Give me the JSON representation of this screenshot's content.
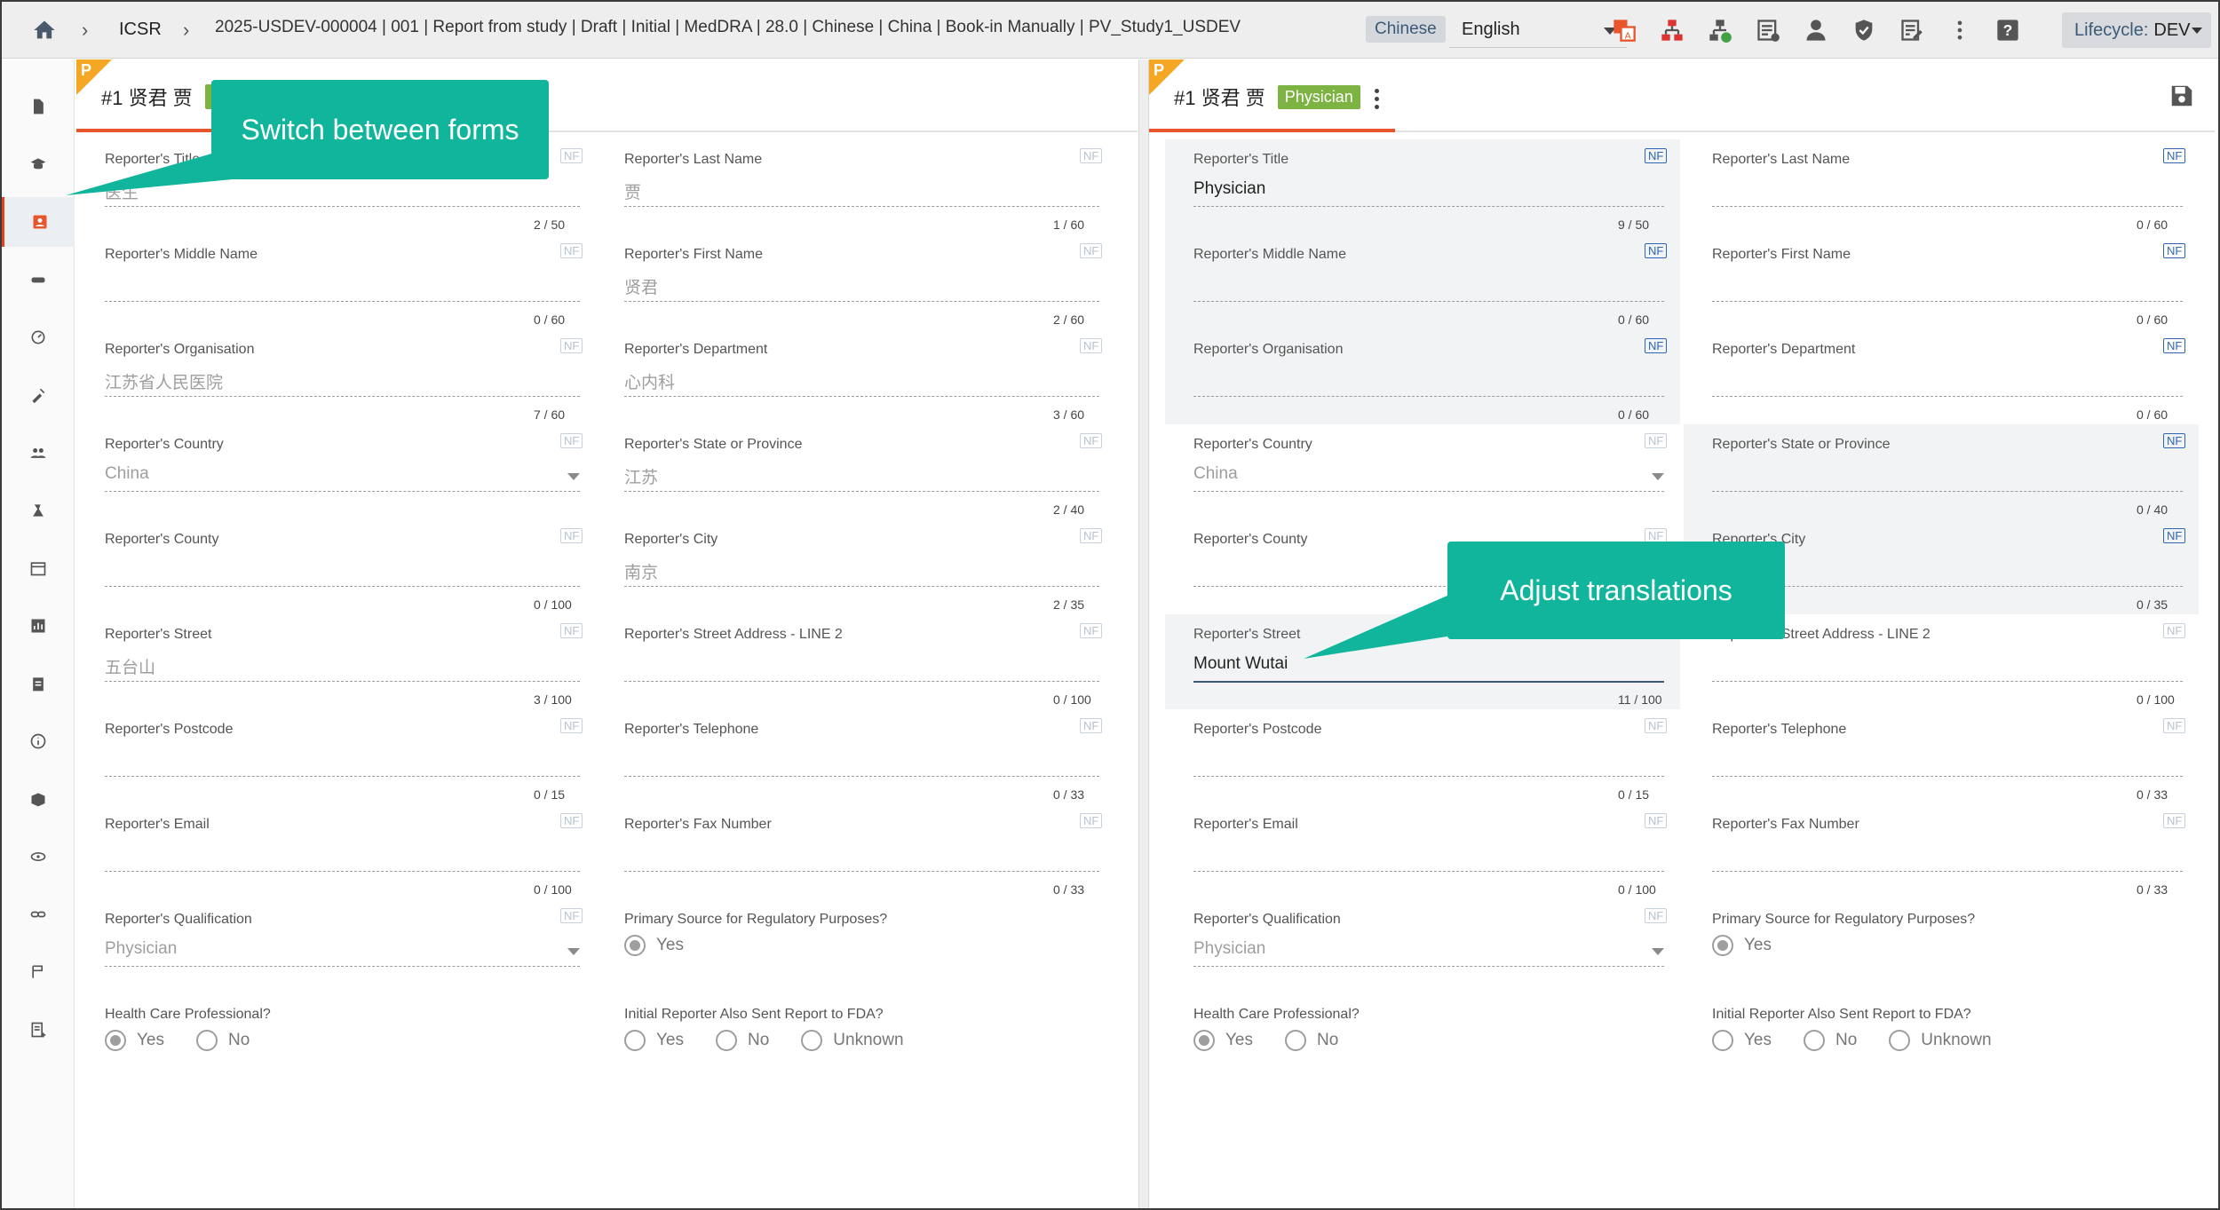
{
  "topbar": {
    "app": "ICSR",
    "path": "2025-USDEV-000004 | 001 | Report from study | Draft | Initial | MedDRA | 28.0 | Chinese | China | Book-in Manually | PV_Study1_USDEV",
    "source_language": "Chinese",
    "target_language": "English",
    "lifecycle_label": "Lifecycle:",
    "lifecycle_value": "DEV",
    "icons": [
      "translate-icon",
      "network-icon",
      "network-add-icon",
      "list-icon",
      "user-download-icon",
      "shield-icon",
      "edit-note-icon",
      "more-vert-icon",
      "help-icon"
    ]
  },
  "nav": {
    "icons": [
      "file-icon",
      "school-icon",
      "contact-icon",
      "pill-icon",
      "speed-icon",
      "syringe-icon",
      "people-icon",
      "edit-flask-icon",
      "calendar-icon",
      "chart-icon",
      "clipboard-icon",
      "info-icon",
      "box-icon",
      "eye-icon",
      "link-icon",
      "flag-icon",
      "note-add-icon"
    ],
    "active": 2
  },
  "left": {
    "tab_title": "#1 贤君 贾",
    "corner": "P",
    "fields": [
      {
        "label": "Reporter's Title",
        "value": "医生",
        "count": "2 / 50",
        "nf": false
      },
      {
        "label": "Reporter's Last Name",
        "value": "贾",
        "count": "1 / 60",
        "nf": false
      },
      {
        "label": "Reporter's Middle Name",
        "value": "",
        "count": "0 / 60",
        "nf": false
      },
      {
        "label": "Reporter's First Name",
        "value": "贤君",
        "count": "2 / 60",
        "nf": false
      },
      {
        "label": "Reporter's Organisation",
        "value": "江苏省人民医院",
        "count": "7 / 60",
        "nf": false
      },
      {
        "label": "Reporter's Department",
        "value": "心内科",
        "count": "3 / 60",
        "nf": false
      },
      {
        "label": "Reporter's Country",
        "value": "China",
        "count": "",
        "nf": false
      },
      {
        "label": "Reporter's State or Province",
        "value": "江苏",
        "count": "2 / 40",
        "nf": false
      },
      {
        "label": "Reporter's County",
        "value": "",
        "count": "0 / 100",
        "nf": false
      },
      {
        "label": "Reporter's City",
        "value": "南京",
        "count": "2 / 35",
        "nf": false
      },
      {
        "label": "Reporter's Street",
        "value": "五台山",
        "count": "3 / 100",
        "nf": false
      },
      {
        "label": "Reporter's Street Address - LINE 2",
        "value": "",
        "count": "0 / 100",
        "nf": false
      },
      {
        "label": "Reporter's Postcode",
        "value": "",
        "count": "0 / 15",
        "nf": false
      },
      {
        "label": "Reporter's Telephone",
        "value": "",
        "count": "0 / 33",
        "nf": false
      },
      {
        "label": "Reporter's Email",
        "value": "",
        "count": "0 / 100",
        "nf": false
      },
      {
        "label": "Reporter's Fax Number",
        "value": "",
        "count": "0 / 33",
        "nf": false
      },
      {
        "label": "Reporter's Qualification",
        "value": "Physician",
        "count": "",
        "nf": false
      },
      {
        "label": "Primary Source for Regulatory Purposes?",
        "options": [
          "Yes"
        ],
        "selected": "Yes"
      },
      {
        "label": "Health Care Professional?",
        "options": [
          "Yes",
          "No"
        ],
        "selected": "Yes"
      },
      {
        "label": "Initial Reporter Also Sent Report to FDA?",
        "options": [
          "Yes",
          "No",
          "Unknown"
        ],
        "selected": ""
      }
    ]
  },
  "right": {
    "tab_title": "#1 贤君 贾",
    "corner": "P",
    "badge": "Physician",
    "fields": [
      {
        "label": "Reporter's Title",
        "value": "Physician",
        "count": "9 / 50",
        "nf": true,
        "hl": true
      },
      {
        "label": "Reporter's Last Name",
        "value": "",
        "count": "0 / 60",
        "nf": true,
        "hl": false
      },
      {
        "label": "Reporter's Middle Name",
        "value": "",
        "count": "0 / 60",
        "nf": true,
        "hl": true
      },
      {
        "label": "Reporter's First Name",
        "value": "",
        "count": "0 / 60",
        "nf": true,
        "hl": false
      },
      {
        "label": "Reporter's Organisation",
        "value": "",
        "count": "0 / 60",
        "nf": true,
        "hl": true
      },
      {
        "label": "Reporter's Department",
        "value": "",
        "count": "0 / 60",
        "nf": true,
        "hl": false
      },
      {
        "label": "Reporter's Country",
        "value": "China",
        "count": "",
        "nf": false,
        "hl": false
      },
      {
        "label": "Reporter's State or Province",
        "value": "",
        "count": "0 / 40",
        "nf": true,
        "hl": true
      },
      {
        "label": "Reporter's County",
        "value": "",
        "count": "",
        "nf": false,
        "hl": false
      },
      {
        "label": "Reporter's City",
        "value": "",
        "count": "0 / 35",
        "nf": true,
        "hl": true
      },
      {
        "label": "Reporter's Street",
        "value": "Mount Wutai",
        "count": "11 / 100",
        "nf": false,
        "hl": true
      },
      {
        "label": "Reporter's Street Address - LINE 2",
        "value": "",
        "count": "0 / 100",
        "nf": false,
        "hl": false
      },
      {
        "label": "Reporter's Postcode",
        "value": "",
        "count": "0 / 15",
        "nf": false,
        "hl": false
      },
      {
        "label": "Reporter's Telephone",
        "value": "",
        "count": "0 / 33",
        "nf": false,
        "hl": false
      },
      {
        "label": "Reporter's Email",
        "value": "",
        "count": "0 / 100",
        "nf": false,
        "hl": false
      },
      {
        "label": "Reporter's Fax Number",
        "value": "",
        "count": "0 / 33",
        "nf": false,
        "hl": false
      },
      {
        "label": "Reporter's Qualification",
        "value": "Physician",
        "count": "",
        "nf": false,
        "hl": false
      },
      {
        "label": "Primary Source for Regulatory Purposes?",
        "options": [
          "Yes"
        ],
        "selected": "Yes"
      },
      {
        "label": "Health Care Professional?",
        "options": [
          "Yes",
          "No"
        ],
        "selected": "Yes"
      },
      {
        "label": "Initial Reporter Also Sent Report to FDA?",
        "options": [
          "Yes",
          "No",
          "Unknown"
        ],
        "selected": ""
      }
    ]
  },
  "nf_label": "NF",
  "callouts": {
    "switch_forms": "Switch between forms",
    "adjust_translations": "Adjust translations"
  },
  "colors": {
    "accent": "#e8552d",
    "callout": "#11b59c",
    "badge": "#7cb342",
    "corner": "#f5a623"
  }
}
